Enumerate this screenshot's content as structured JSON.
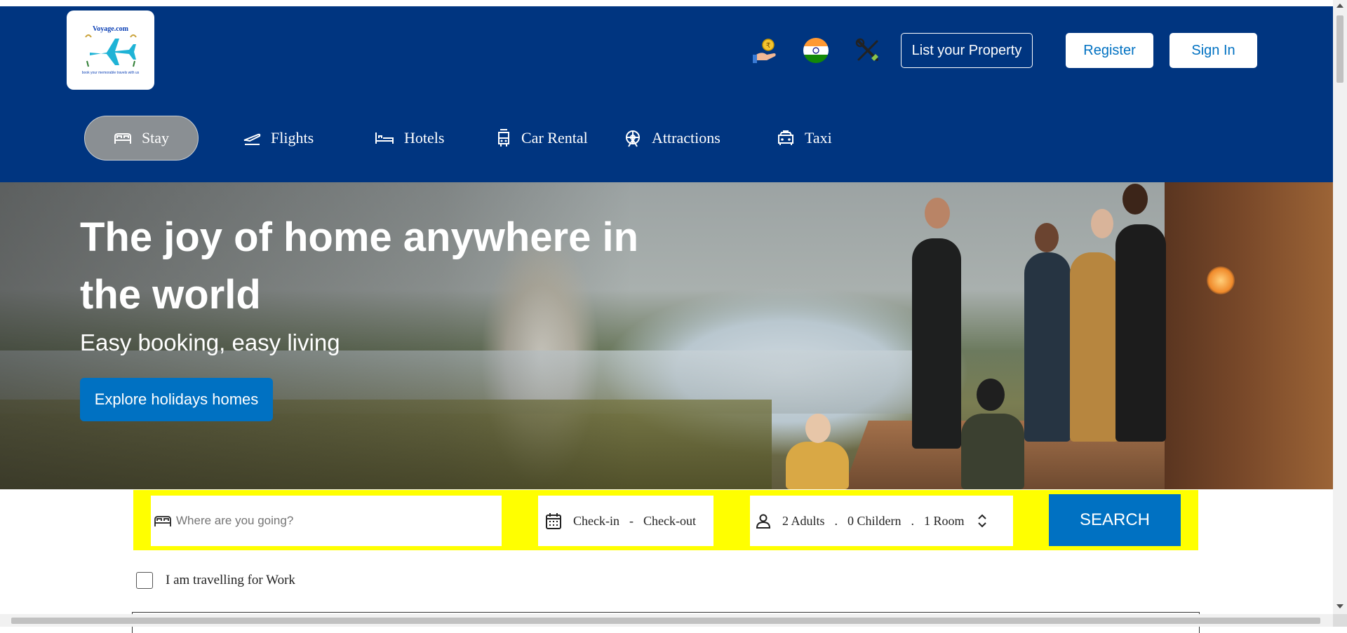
{
  "brand": {
    "name": "Voyage.com",
    "tagline": "book your memorable travels with us"
  },
  "header": {
    "list_property": "List your Property",
    "register": "Register",
    "sign_in": "Sign In",
    "icons": [
      "currency-rupee-icon",
      "india-flag-icon",
      "tools-icon"
    ]
  },
  "nav": {
    "items": [
      {
        "label": "Stay",
        "icon": "bed-icon",
        "active": true
      },
      {
        "label": "Flights",
        "icon": "plane-takeoff-icon",
        "active": false
      },
      {
        "label": "Hotels",
        "icon": "hotel-bed-icon",
        "active": false
      },
      {
        "label": "Car Rental",
        "icon": "car-rental-icon",
        "active": false
      },
      {
        "label": "Attractions",
        "icon": "ferris-wheel-icon",
        "active": false
      },
      {
        "label": "Taxi",
        "icon": "taxi-icon",
        "active": false
      }
    ]
  },
  "hero": {
    "title": "The joy of home anywhere in the world",
    "subtitle": "Easy booking, easy living",
    "cta": "Explore holidays homes"
  },
  "search": {
    "destination_placeholder": "Where are you going?",
    "checkin": "Check-in",
    "separator": "-",
    "checkout": "Check-out",
    "adults": "2 Adults",
    "children": "0 Childern",
    "rooms": "1 Room",
    "dot": ".",
    "button": "SEARCH"
  },
  "work_travel": {
    "label": "I am travelling for Work",
    "checked": false
  },
  "colors": {
    "header_bg": "#003580",
    "accent": "#0071c2",
    "search_bar": "#ffff00",
    "active_nav": "#8a8f93"
  }
}
